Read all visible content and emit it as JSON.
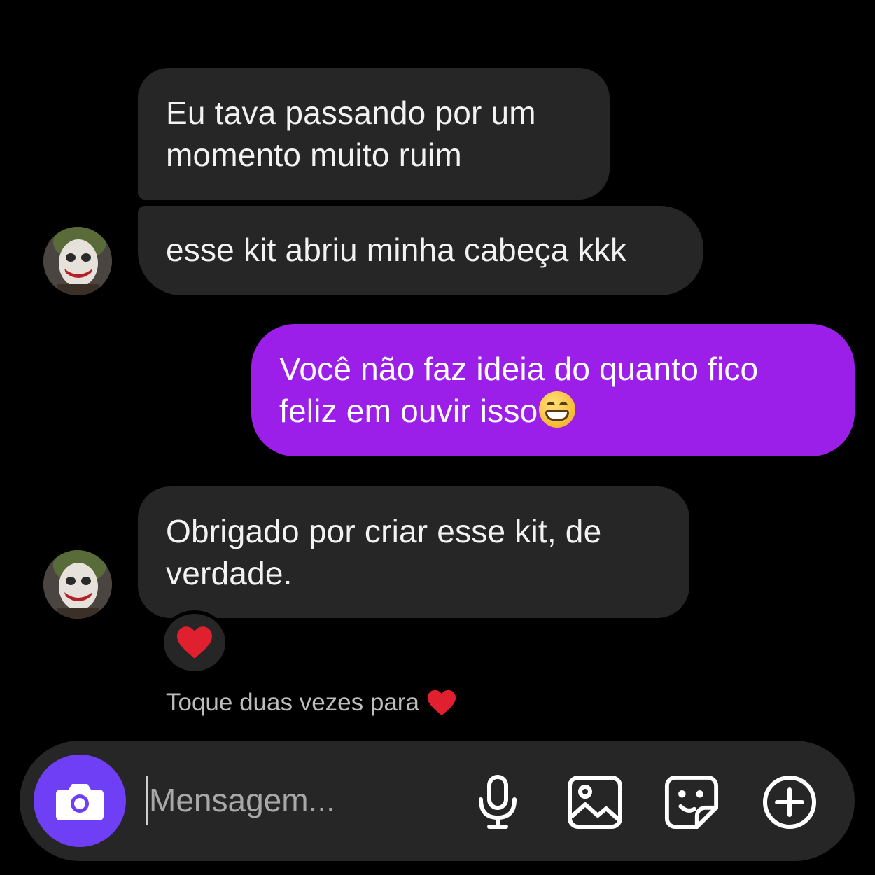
{
  "conversation": {
    "messages": [
      {
        "sender": "other",
        "text_line1": "Eu tava passando por um",
        "text_line2": "momento muito ruim"
      },
      {
        "sender": "other",
        "text": "esse kit abriu minha cabeça kkk"
      },
      {
        "sender": "me",
        "text_line1": "Você não faz ideia do quanto fico",
        "text_line2": "feliz em ouvir isso",
        "trailing_emoji": "grinning-face-emoji"
      },
      {
        "sender": "other",
        "text_line1": "Obrigado por criar esse kit, de",
        "text_line2": "verdade.",
        "reaction": "red-heart"
      }
    ],
    "double_tap_hint": "Toque duas vezes para",
    "hint_icon": "red-heart"
  },
  "composer": {
    "placeholder": "Mensagem...",
    "value": "",
    "buttons": [
      "camera-icon",
      "microphone-icon",
      "gallery-icon",
      "sticker-icon",
      "plus-circle-icon"
    ]
  },
  "colors": {
    "background": "#000000",
    "incoming_bubble": "#262626",
    "outgoing_bubble": "#9b1fe8",
    "camera_button": "#6e3ff5",
    "heart": "#e0202e"
  }
}
